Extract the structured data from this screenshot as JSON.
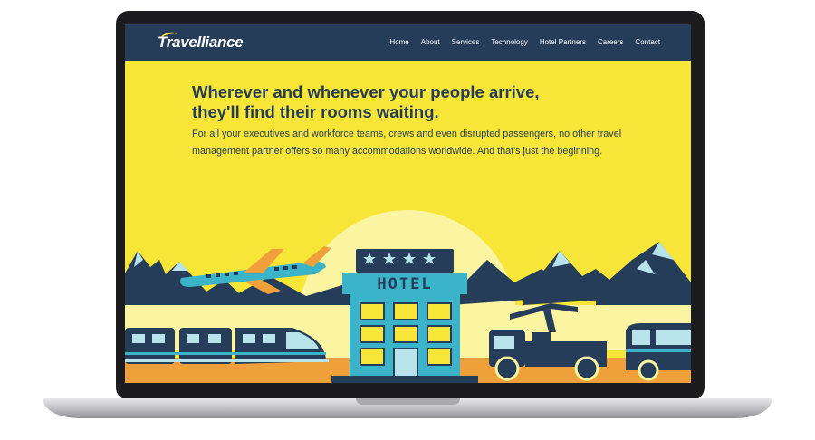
{
  "nav": {
    "logo": "Travelliance",
    "links": [
      "Home",
      "About",
      "Services",
      "Technology",
      "Hotel Partners",
      "Careers",
      "Contact"
    ]
  },
  "hero": {
    "headline_line1": "Wherever and whenever your people arrive,",
    "headline_line2": "they'll find their rooms waiting.",
    "body": "For all your executives and workforce teams, crews and even disrupted passengers, no other travel management partner offers so many accommodations worldwide. And that's just the beginning."
  },
  "illustration": {
    "hotel_sign": "HOTEL"
  },
  "colors": {
    "navy": "#263d5a",
    "yellow": "#f7e637",
    "teal": "#3bb3c9",
    "orange": "#f0a03a"
  }
}
